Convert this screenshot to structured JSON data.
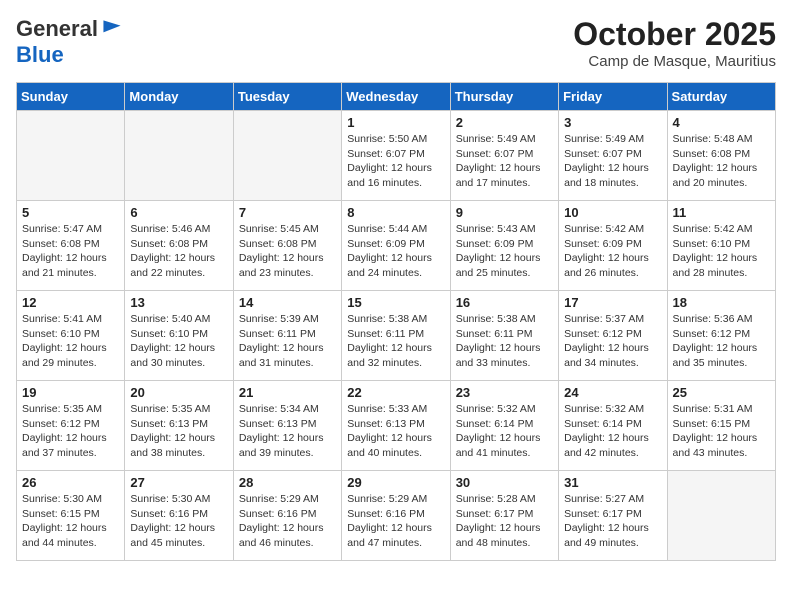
{
  "header": {
    "logo_line1": "General",
    "logo_line2": "Blue",
    "month": "October 2025",
    "location": "Camp de Masque, Mauritius"
  },
  "weekdays": [
    "Sunday",
    "Monday",
    "Tuesday",
    "Wednesday",
    "Thursday",
    "Friday",
    "Saturday"
  ],
  "weeks": [
    [
      {
        "day": "",
        "info": ""
      },
      {
        "day": "",
        "info": ""
      },
      {
        "day": "",
        "info": ""
      },
      {
        "day": "1",
        "info": "Sunrise: 5:50 AM\nSunset: 6:07 PM\nDaylight: 12 hours and 16 minutes."
      },
      {
        "day": "2",
        "info": "Sunrise: 5:49 AM\nSunset: 6:07 PM\nDaylight: 12 hours and 17 minutes."
      },
      {
        "day": "3",
        "info": "Sunrise: 5:49 AM\nSunset: 6:07 PM\nDaylight: 12 hours and 18 minutes."
      },
      {
        "day": "4",
        "info": "Sunrise: 5:48 AM\nSunset: 6:08 PM\nDaylight: 12 hours and 20 minutes."
      }
    ],
    [
      {
        "day": "5",
        "info": "Sunrise: 5:47 AM\nSunset: 6:08 PM\nDaylight: 12 hours and 21 minutes."
      },
      {
        "day": "6",
        "info": "Sunrise: 5:46 AM\nSunset: 6:08 PM\nDaylight: 12 hours and 22 minutes."
      },
      {
        "day": "7",
        "info": "Sunrise: 5:45 AM\nSunset: 6:08 PM\nDaylight: 12 hours and 23 minutes."
      },
      {
        "day": "8",
        "info": "Sunrise: 5:44 AM\nSunset: 6:09 PM\nDaylight: 12 hours and 24 minutes."
      },
      {
        "day": "9",
        "info": "Sunrise: 5:43 AM\nSunset: 6:09 PM\nDaylight: 12 hours and 25 minutes."
      },
      {
        "day": "10",
        "info": "Sunrise: 5:42 AM\nSunset: 6:09 PM\nDaylight: 12 hours and 26 minutes."
      },
      {
        "day": "11",
        "info": "Sunrise: 5:42 AM\nSunset: 6:10 PM\nDaylight: 12 hours and 28 minutes."
      }
    ],
    [
      {
        "day": "12",
        "info": "Sunrise: 5:41 AM\nSunset: 6:10 PM\nDaylight: 12 hours and 29 minutes."
      },
      {
        "day": "13",
        "info": "Sunrise: 5:40 AM\nSunset: 6:10 PM\nDaylight: 12 hours and 30 minutes."
      },
      {
        "day": "14",
        "info": "Sunrise: 5:39 AM\nSunset: 6:11 PM\nDaylight: 12 hours and 31 minutes."
      },
      {
        "day": "15",
        "info": "Sunrise: 5:38 AM\nSunset: 6:11 PM\nDaylight: 12 hours and 32 minutes."
      },
      {
        "day": "16",
        "info": "Sunrise: 5:38 AM\nSunset: 6:11 PM\nDaylight: 12 hours and 33 minutes."
      },
      {
        "day": "17",
        "info": "Sunrise: 5:37 AM\nSunset: 6:12 PM\nDaylight: 12 hours and 34 minutes."
      },
      {
        "day": "18",
        "info": "Sunrise: 5:36 AM\nSunset: 6:12 PM\nDaylight: 12 hours and 35 minutes."
      }
    ],
    [
      {
        "day": "19",
        "info": "Sunrise: 5:35 AM\nSunset: 6:12 PM\nDaylight: 12 hours and 37 minutes."
      },
      {
        "day": "20",
        "info": "Sunrise: 5:35 AM\nSunset: 6:13 PM\nDaylight: 12 hours and 38 minutes."
      },
      {
        "day": "21",
        "info": "Sunrise: 5:34 AM\nSunset: 6:13 PM\nDaylight: 12 hours and 39 minutes."
      },
      {
        "day": "22",
        "info": "Sunrise: 5:33 AM\nSunset: 6:13 PM\nDaylight: 12 hours and 40 minutes."
      },
      {
        "day": "23",
        "info": "Sunrise: 5:32 AM\nSunset: 6:14 PM\nDaylight: 12 hours and 41 minutes."
      },
      {
        "day": "24",
        "info": "Sunrise: 5:32 AM\nSunset: 6:14 PM\nDaylight: 12 hours and 42 minutes."
      },
      {
        "day": "25",
        "info": "Sunrise: 5:31 AM\nSunset: 6:15 PM\nDaylight: 12 hours and 43 minutes."
      }
    ],
    [
      {
        "day": "26",
        "info": "Sunrise: 5:30 AM\nSunset: 6:15 PM\nDaylight: 12 hours and 44 minutes."
      },
      {
        "day": "27",
        "info": "Sunrise: 5:30 AM\nSunset: 6:16 PM\nDaylight: 12 hours and 45 minutes."
      },
      {
        "day": "28",
        "info": "Sunrise: 5:29 AM\nSunset: 6:16 PM\nDaylight: 12 hours and 46 minutes."
      },
      {
        "day": "29",
        "info": "Sunrise: 5:29 AM\nSunset: 6:16 PM\nDaylight: 12 hours and 47 minutes."
      },
      {
        "day": "30",
        "info": "Sunrise: 5:28 AM\nSunset: 6:17 PM\nDaylight: 12 hours and 48 minutes."
      },
      {
        "day": "31",
        "info": "Sunrise: 5:27 AM\nSunset: 6:17 PM\nDaylight: 12 hours and 49 minutes."
      },
      {
        "day": "",
        "info": ""
      }
    ]
  ]
}
